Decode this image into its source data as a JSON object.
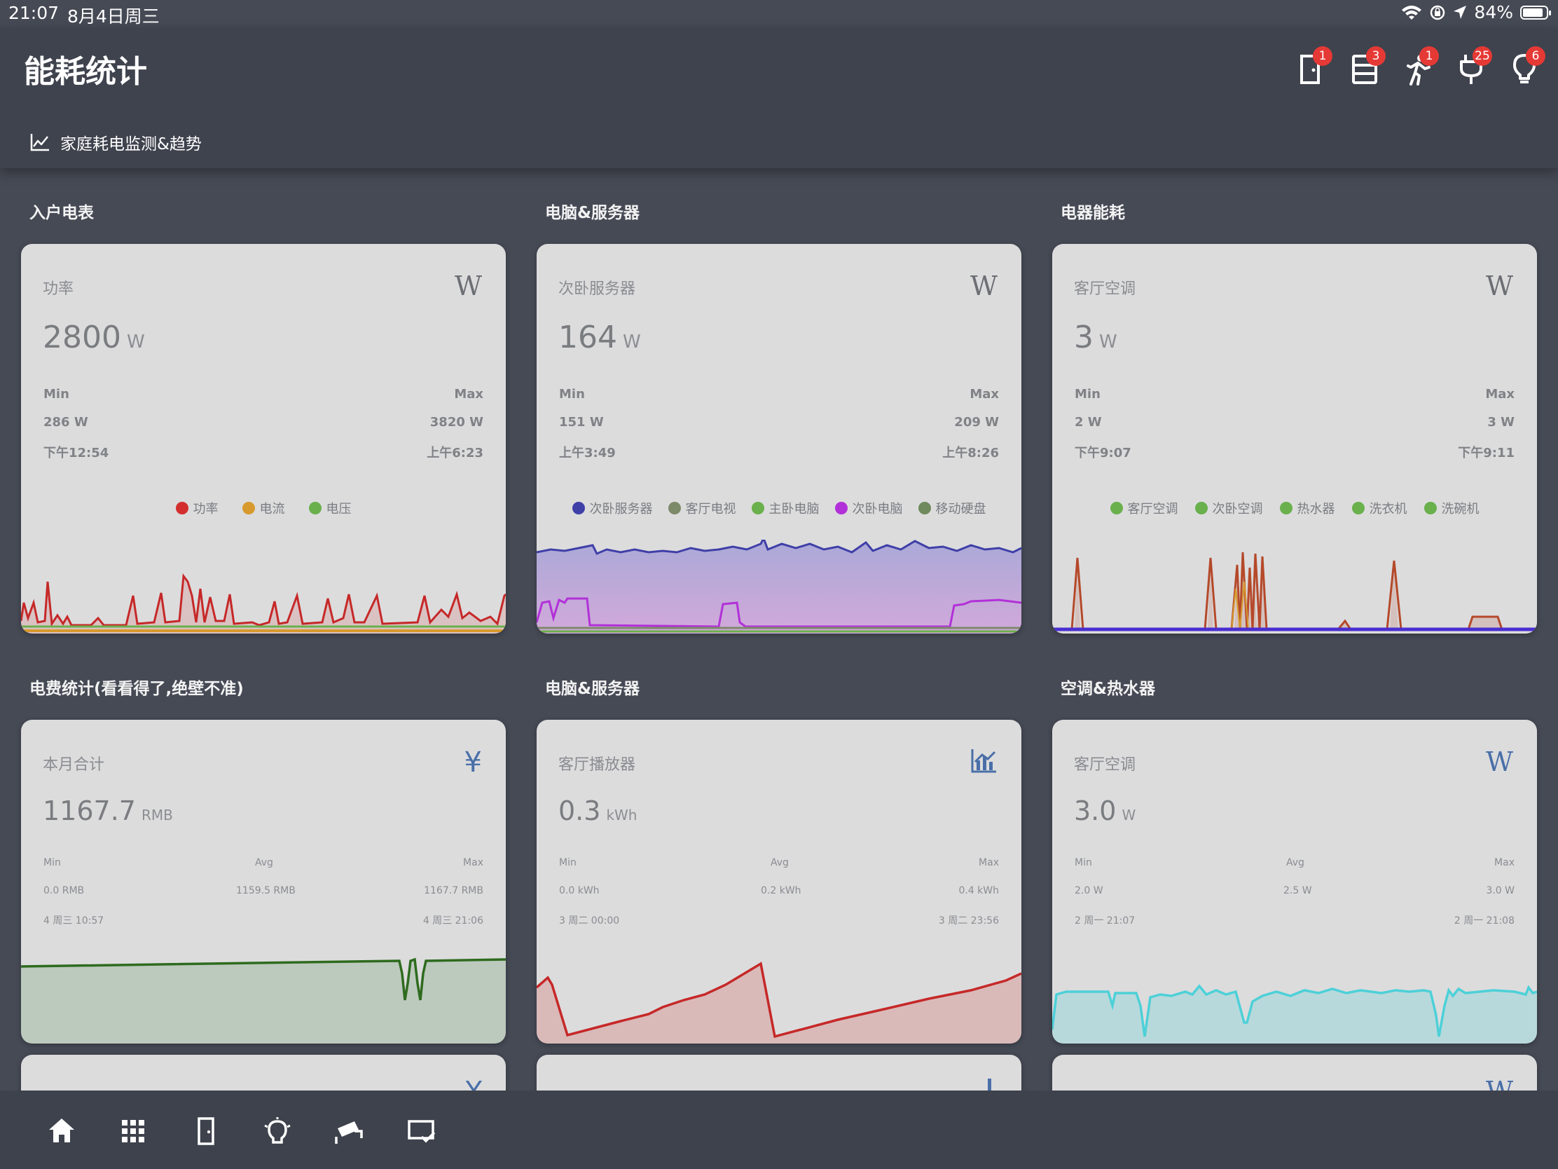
{
  "status": {
    "time": "21:07",
    "date": "8月4日周三",
    "battery": "84%"
  },
  "header": {
    "title": "能耗统计",
    "badges": [
      "1",
      "3",
      "1",
      "25",
      "6"
    ],
    "tab_label": "家庭耗电监测&趋势"
  },
  "sections": [
    {
      "title": "入户电表"
    },
    {
      "title": "电脑&服务器"
    },
    {
      "title": "电器能耗"
    },
    {
      "title": "电费统计(看看得了,绝壁不准)"
    },
    {
      "title": "电脑&服务器"
    },
    {
      "title": "空调&热水器"
    }
  ],
  "cards": [
    {
      "name": "功率",
      "icon": "W",
      "value": "2800",
      "unit": "W",
      "min_label": "Min",
      "max_label": "Max",
      "min": "286 W",
      "max": "3820 W",
      "min_time": "下午12:54",
      "max_time": "上午6:23",
      "legend": [
        {
          "label": "功率",
          "color": "#d32f2f"
        },
        {
          "label": "电流",
          "color": "#d89a2e"
        },
        {
          "label": "电压",
          "color": "#6ab04c"
        }
      ]
    },
    {
      "name": "次卧服务器",
      "icon": "W",
      "value": "164",
      "unit": "W",
      "min_label": "Min",
      "max_label": "Max",
      "min": "151 W",
      "max": "209 W",
      "min_time": "上午3:49",
      "max_time": "上午8:26",
      "legend": [
        {
          "label": "次卧服务器",
          "color": "#3f3fa8"
        },
        {
          "label": "客厅电视",
          "color": "#7d8a6a"
        },
        {
          "label": "主卧电脑",
          "color": "#6ab04c"
        },
        {
          "label": "次卧电脑",
          "color": "#b230d8"
        },
        {
          "label": "移动硬盘",
          "color": "#6f8a5c"
        }
      ]
    },
    {
      "name": "客厅空调",
      "icon": "W",
      "value": "3",
      "unit": "W",
      "min_label": "Min",
      "max_label": "Max",
      "min": "2 W",
      "max": "3 W",
      "min_time": "下午9:07",
      "max_time": "下午9:11",
      "legend": [
        {
          "label": "客厅空调",
          "color": "#6ab04c"
        },
        {
          "label": "次卧空调",
          "color": "#6ab04c"
        },
        {
          "label": "热水器",
          "color": "#6ab04c"
        },
        {
          "label": "洗衣机",
          "color": "#6ab04c"
        },
        {
          "label": "洗碗机",
          "color": "#6ab04c"
        }
      ]
    },
    {
      "name": "本月合计",
      "icon": "¥",
      "value": "1167.7",
      "unit": "RMB",
      "min_label": "Min",
      "avg_label": "Avg",
      "max_label": "Max",
      "min": "0.0 RMB",
      "avg": "1159.5 RMB",
      "max": "1167.7 RMB",
      "min_time": "4 周三 10:57",
      "max_time": "4 周三 21:06"
    },
    {
      "name": "客厅播放器",
      "icon": "chart-icon",
      "value": "0.3",
      "unit": "kWh",
      "min_label": "Min",
      "avg_label": "Avg",
      "max_label": "Max",
      "min": "0.0 kWh",
      "avg": "0.2 kWh",
      "max": "0.4 kWh",
      "min_time": "3 周二 00:00",
      "max_time": "3 周二 23:56"
    },
    {
      "name": "客厅空调",
      "icon": "W",
      "value": "3.0",
      "unit": "W",
      "min_label": "Min",
      "avg_label": "Avg",
      "max_label": "Max",
      "min": "2.0 W",
      "avg": "2.5 W",
      "max": "3.0 W",
      "min_time": "2 周一 21:07",
      "max_time": "2 周一 21:08"
    }
  ],
  "partial_icons": [
    "Y",
    "chart-icon",
    "W"
  ],
  "bottom_nav": [
    "home-icon",
    "apps-grid-icon",
    "door-icon",
    "lighting-icon",
    "cctv-camera-icon",
    "task-check-icon"
  ]
}
